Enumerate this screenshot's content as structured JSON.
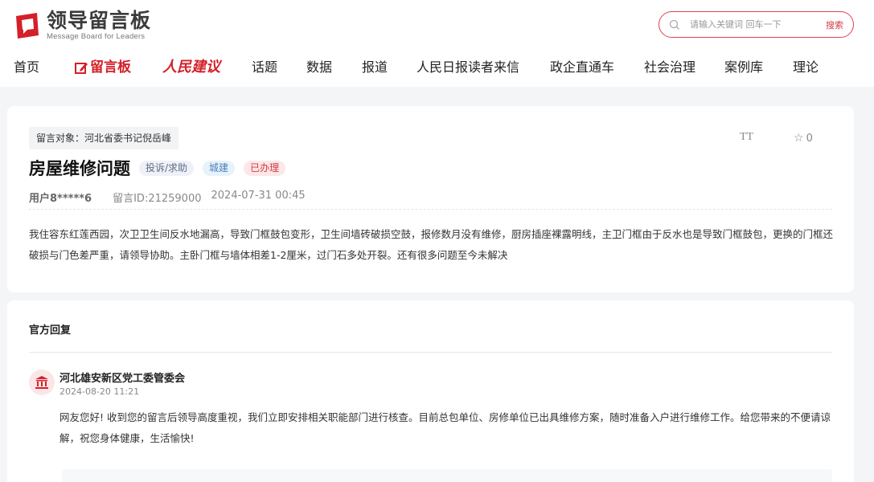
{
  "header": {
    "logo_title": "领导留言板",
    "logo_subtitle": "Message Board for Leaders",
    "search_placeholder": "请输入关键词 回车一下",
    "search_button": "搜索"
  },
  "nav": {
    "items": [
      "首页",
      "留言板",
      "人民建议",
      "话题",
      "数据",
      "报道",
      "人民日报读者来信",
      "政企直通车",
      "社会治理",
      "案例库",
      "理论"
    ]
  },
  "message": {
    "target": "留言对象：河北省委书记倪岳峰",
    "font_size_label": "TT",
    "favorite_count": "0",
    "title": "房屋维修问题",
    "tags": [
      "投诉/求助",
      "城建",
      "已办理"
    ],
    "user": "用户8*****6",
    "message_id": "留言ID:21259000",
    "datetime": "2024-07-31 00:45",
    "content": "我住容东红莲西园，次卫卫生间反水地漏高，导致门框鼓包变形，卫生间墙砖破损空鼓，报修数月没有维修，厨房插座裸露明线，主卫门框由于反水也是导致门框鼓包，更换的门框还破损与门色差严重，请领导协助。主卧门框与墙体相差1-2厘米，过门石多处开裂。还有很多问题至今未解决"
  },
  "reply": {
    "heading": "官方回复",
    "org": "河北雄安新区党工委管委会",
    "datetime": "2024-08-20 11:21",
    "content": "网友您好! 收到您的留言后领导高度重视，我们立即安排相关职能部门进行核查。目前总包单位、房修单位已出具维修方案，随时准备入户进行维修工作。给您带来的不便请谅解，祝您身体健康，生活愉快!"
  },
  "colors": {
    "brand_red": "#d4202a",
    "page_bg": "#f4f5f7"
  }
}
